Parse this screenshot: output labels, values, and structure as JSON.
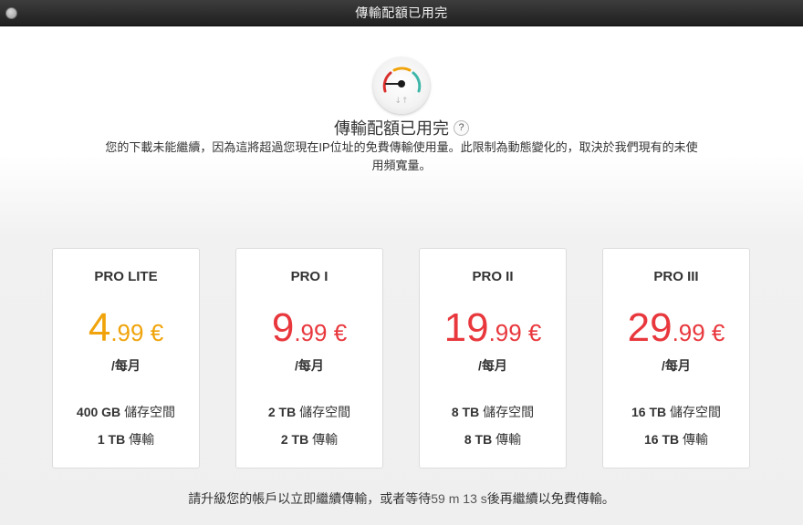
{
  "window": {
    "title": "傳輸配額已用完"
  },
  "header": {
    "headline": "傳輸配額已用完",
    "help_icon_text": "?",
    "description": "您的下載未能繼續，因為這將超過您現在IP位址的免費傳輸使用量。此限制為動態變化的，取決於我們現有的未使用頻寬量。"
  },
  "colors": {
    "lite_accent": "#f0a30a",
    "pro_accent": "#e8383d",
    "gauge_red": "#d9302c",
    "gauge_yellow": "#f0a30a",
    "gauge_teal": "#3fb6a8"
  },
  "plans": [
    {
      "name": "PRO LITE",
      "price_int": "4",
      "price_dec": ".99 €",
      "period": "/每月",
      "storage_amount": "400 GB",
      "storage_label": "儲存空間",
      "transfer_amount": "1 TB",
      "transfer_label": "傳輸"
    },
    {
      "name": "PRO I",
      "price_int": "9",
      "price_dec": ".99 €",
      "period": "/每月",
      "storage_amount": "2 TB",
      "storage_label": "儲存空間",
      "transfer_amount": "2 TB",
      "transfer_label": "傳輸"
    },
    {
      "name": "PRO II",
      "price_int": "19",
      "price_dec": ".99 €",
      "period": "/每月",
      "storage_amount": "8 TB",
      "storage_label": "儲存空間",
      "transfer_amount": "8 TB",
      "transfer_label": "傳輸"
    },
    {
      "name": "PRO III",
      "price_int": "29",
      "price_dec": ".99 €",
      "period": "/每月",
      "storage_amount": "16 TB",
      "storage_label": "儲存空間",
      "transfer_amount": "16 TB",
      "transfer_label": "傳輸"
    }
  ],
  "footer": {
    "prefix": "請升級您的帳戶以立即繼續傳輸，或者等待",
    "minutes": "59",
    "min_unit": "m",
    "seconds": "13",
    "sec_unit": "s",
    "suffix": "後再繼續以免費傳輸。"
  },
  "icons": {
    "gauge": "transfer-quota-gauge-icon",
    "close": "window-close-icon",
    "help": "help-icon"
  }
}
